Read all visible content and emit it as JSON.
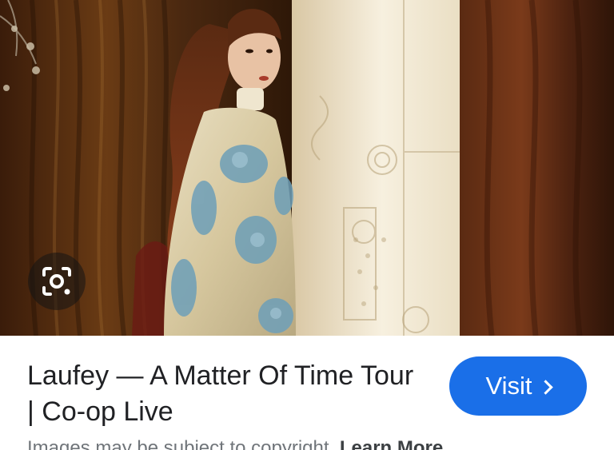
{
  "result": {
    "title": "Laufey — A Matter Of Time Tour | Co-op Live",
    "visit_label": "Visit",
    "copyright_text": "Images may be subject to copyright.",
    "learn_more_label": "Learn More"
  },
  "icons": {
    "lens": "google-lens-icon",
    "visit_chevron": "chevron-right-icon"
  },
  "colors": {
    "visit_button": "#1a6fe8",
    "title_text": "#202124",
    "secondary_text": "#70757a"
  }
}
